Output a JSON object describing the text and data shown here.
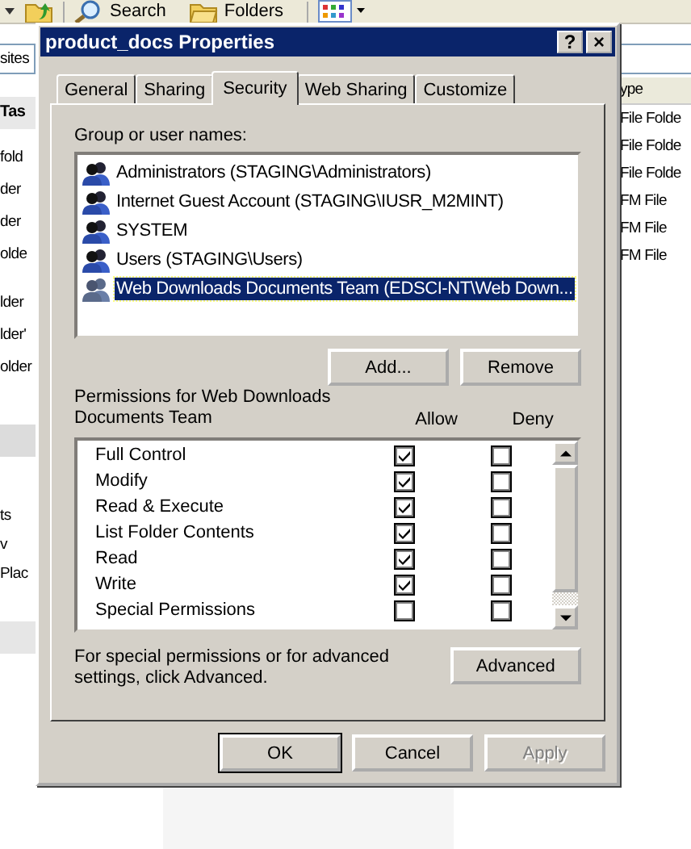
{
  "explorer": {
    "toolbar": {
      "buttons": [
        {
          "label": "Search",
          "kind": "search"
        },
        {
          "label": "Folders",
          "kind": "folders"
        }
      ]
    },
    "left_pane": {
      "address": "sites",
      "header": "Tas",
      "groups": [
        [
          "fold",
          "der",
          "der",
          "olde"
        ],
        [
          "lder",
          "lder'",
          "older"
        ],
        [
          "ts",
          "v",
          "Plac"
        ]
      ]
    },
    "right_pane": {
      "column": "ype",
      "cells": [
        "File Folde",
        "File Folde",
        "File Folde",
        "FM File",
        "FM File",
        "FM File"
      ]
    }
  },
  "dialog": {
    "title": "product_docs Properties",
    "help_button": "?",
    "close_button": "×",
    "tabs": [
      {
        "label": "General",
        "selected": false
      },
      {
        "label": "Sharing",
        "selected": false
      },
      {
        "label": "Security",
        "selected": true
      },
      {
        "label": "Web Sharing",
        "selected": false
      },
      {
        "label": "Customize",
        "selected": false
      }
    ],
    "group_label": "Group or user names:",
    "principals": [
      {
        "name": "Administrators (STAGING\\Administrators)",
        "selected": false
      },
      {
        "name": "Internet Guest Account (STAGING\\IUSR_M2MINT)",
        "selected": false
      },
      {
        "name": "SYSTEM",
        "selected": false
      },
      {
        "name": "Users (STAGING\\Users)",
        "selected": false
      },
      {
        "name": "Web Downloads Documents Team (EDSCI-NT\\Web Down...",
        "selected": true
      }
    ],
    "add_button": "Add...",
    "remove_button": "Remove",
    "permissions_label": "Permissions for Web Downloads Documents Team",
    "allow_header": "Allow",
    "deny_header": "Deny",
    "permissions": [
      {
        "name": "Full Control",
        "allow": true,
        "deny": false
      },
      {
        "name": "Modify",
        "allow": true,
        "deny": false
      },
      {
        "name": "Read & Execute",
        "allow": true,
        "deny": false
      },
      {
        "name": "List Folder Contents",
        "allow": true,
        "deny": false
      },
      {
        "name": "Read",
        "allow": true,
        "deny": false
      },
      {
        "name": "Write",
        "allow": true,
        "deny": false
      },
      {
        "name": "Special Permissions",
        "allow": false,
        "deny": false
      }
    ],
    "advanced_note": "For special permissions or for advanced settings, click Advanced.",
    "advanced_button": "Advanced",
    "footer_buttons": [
      {
        "label": "OK",
        "disabled": false
      },
      {
        "label": "Cancel",
        "disabled": false
      },
      {
        "label": "Apply",
        "disabled": true
      }
    ]
  }
}
